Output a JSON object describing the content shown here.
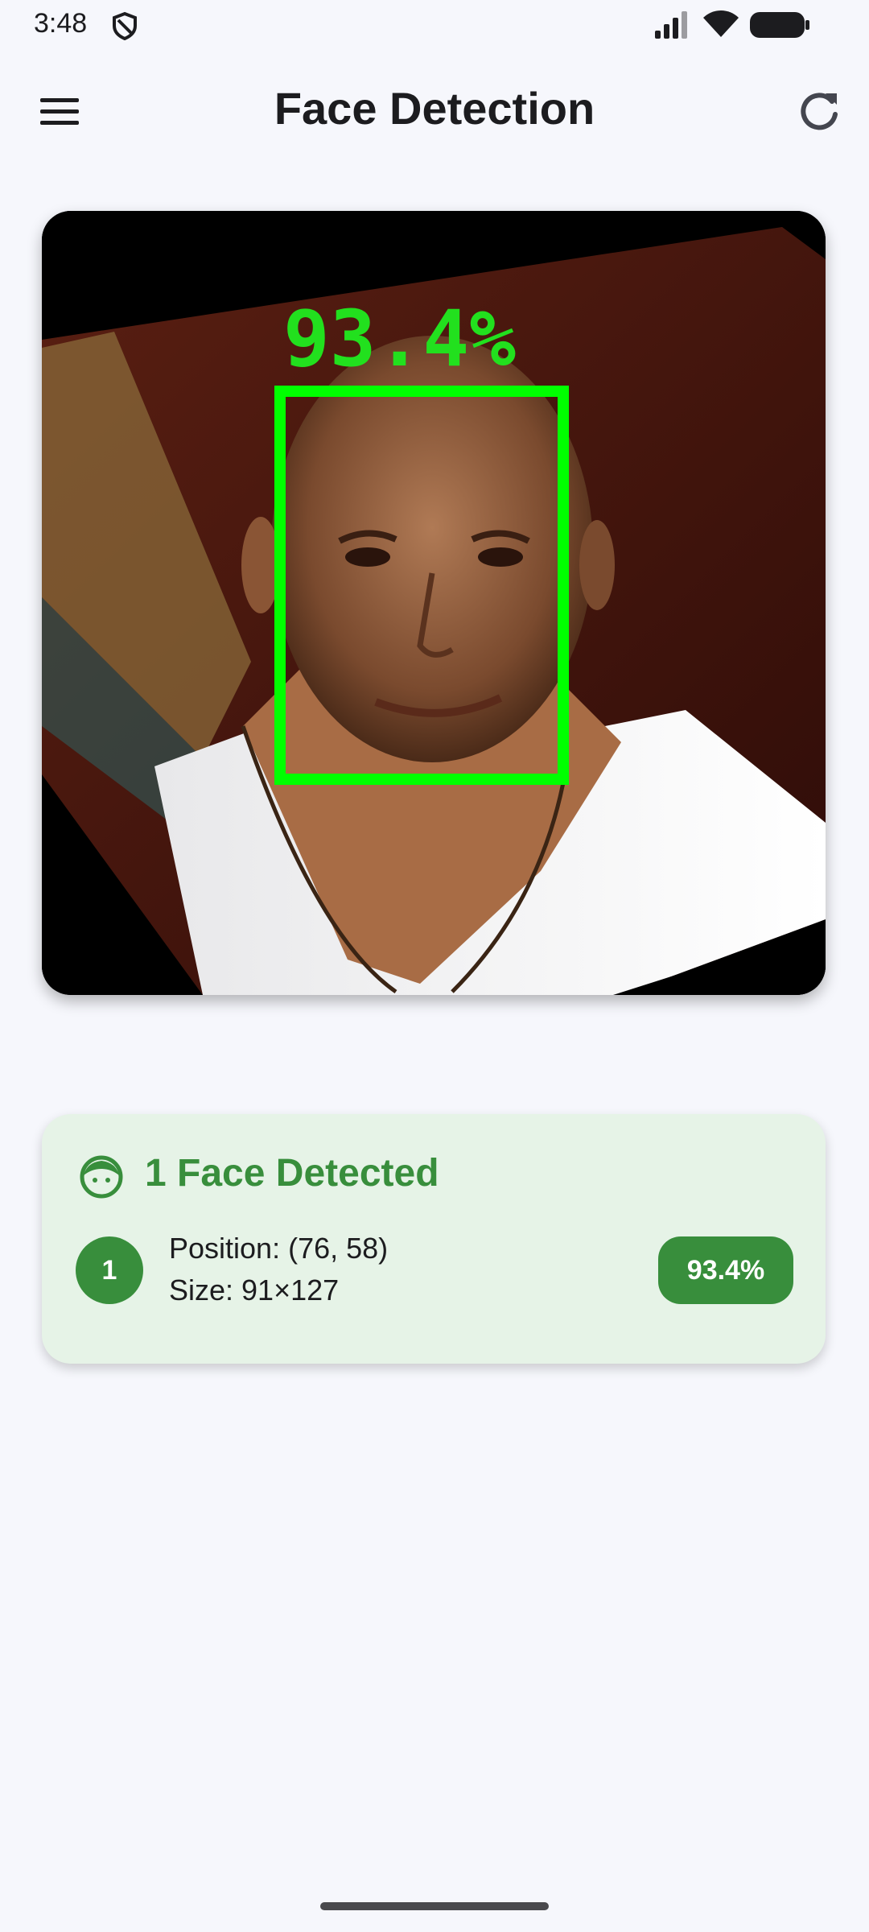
{
  "status_bar": {
    "time": "3:48"
  },
  "app_bar": {
    "title": "Face Detection",
    "menu_icon": "menu-icon",
    "refresh_icon": "refresh-icon"
  },
  "image": {
    "overlay_label": "93.4%",
    "box_color": "#00ff00"
  },
  "result": {
    "icon": "face-icon",
    "title": "1 Face Detected",
    "faces": [
      {
        "index": "1",
        "position": "Position: (76, 58)",
        "size": "Size: 91×127",
        "confidence": "93.4%"
      }
    ]
  },
  "colors": {
    "accent_green": "#388e3c",
    "card_background": "#e6f3e7",
    "page_background": "#f6f7fc"
  }
}
